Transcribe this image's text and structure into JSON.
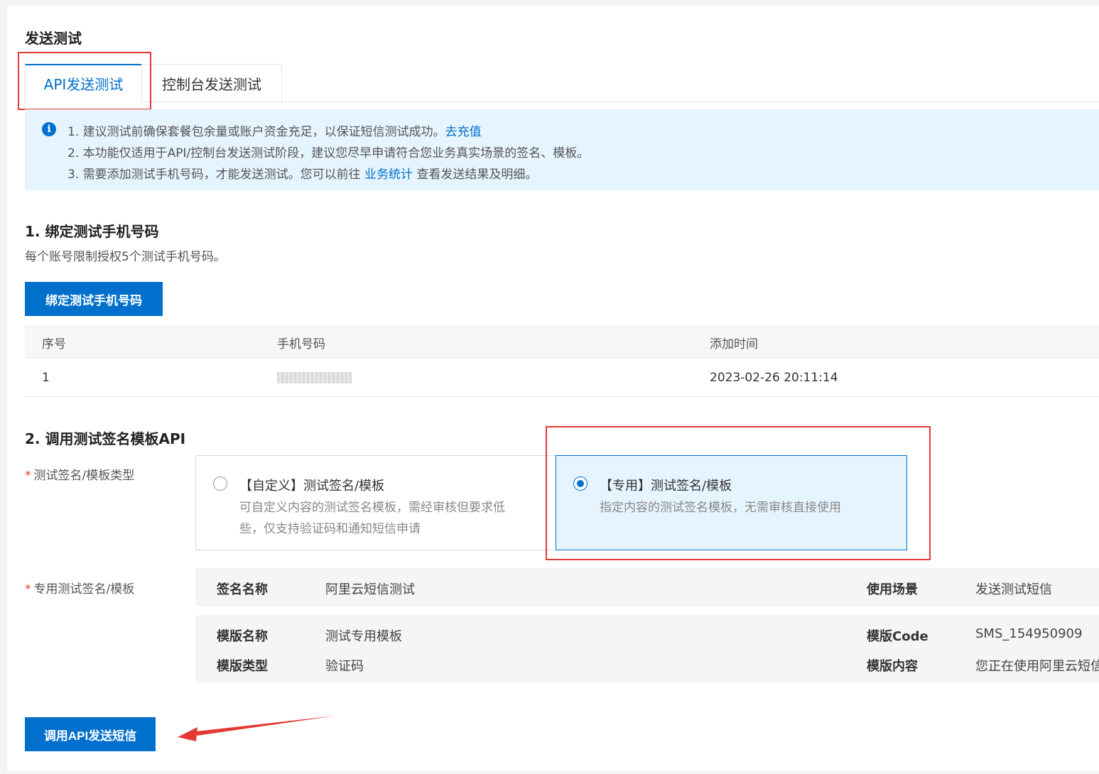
{
  "page": {
    "title": "发送测试"
  },
  "tabs": [
    {
      "label": "API发送测试",
      "active": true
    },
    {
      "label": "控制台发送测试",
      "active": false
    }
  ],
  "notice": {
    "icon": "info-icon",
    "line1_text": "1. 建议测试前确保套餐包余量或账户资金充足，以保证短信测试成功。",
    "line1_link": "去充值",
    "line2_text": "2. 本功能仅适用于API/控制台发送测试阶段，建议您尽早申请符合您业务真实场景的签名、模板。",
    "line3_text_a": "3. 需要添加测试手机号码，才能发送测试。您可以前往 ",
    "line3_link": "业务统计",
    "line3_text_b": " 查看发送结果及明细。"
  },
  "section1": {
    "title": "1. 绑定测试手机号码",
    "desc": "每个账号限制授权5个测试手机号码。",
    "bind_button": "绑定测试手机号码",
    "table": {
      "headers": [
        "序号",
        "手机号码",
        "添加时间"
      ],
      "rows": [
        {
          "index": "1",
          "phone": "",
          "time": "2023-02-26 20:11:14"
        }
      ]
    }
  },
  "section2": {
    "title": "2. 调用测试签名模板API",
    "type_label": "测试签名/模板类型",
    "options": [
      {
        "title": "【自定义】测试签名/模板",
        "desc1": "可自定义内容的测试签名模板，需经审核但要求低",
        "desc2": "些，仅支持验证码和通知短信申请",
        "selected": false
      },
      {
        "title": "【专用】测试签名/模板",
        "desc1": "指定内容的测试签名模板，无需审核直接使用",
        "desc2": "",
        "selected": true
      }
    ],
    "detail_label": "专用测试签名/模板",
    "detail": {
      "sign_name_key": "签名名称",
      "sign_name_val": "阿里云短信测试",
      "scene_key": "使用场景",
      "scene_val": "发送测试短信",
      "tpl_name_key": "模版名称",
      "tpl_name_val": "测试专用模板",
      "tpl_code_key": "模版Code",
      "tpl_code_val": "SMS_154950909",
      "tpl_type_key": "模版类型",
      "tpl_type_val": "验证码",
      "tpl_content_key": "模版内容",
      "tpl_content_val": "您正在使用阿里云短信测试服务"
    },
    "call_button": "调用API发送短信"
  },
  "colors": {
    "primary": "#0070cc",
    "notice_bg": "#e6f4ff",
    "annotation_red": "#e53935"
  }
}
